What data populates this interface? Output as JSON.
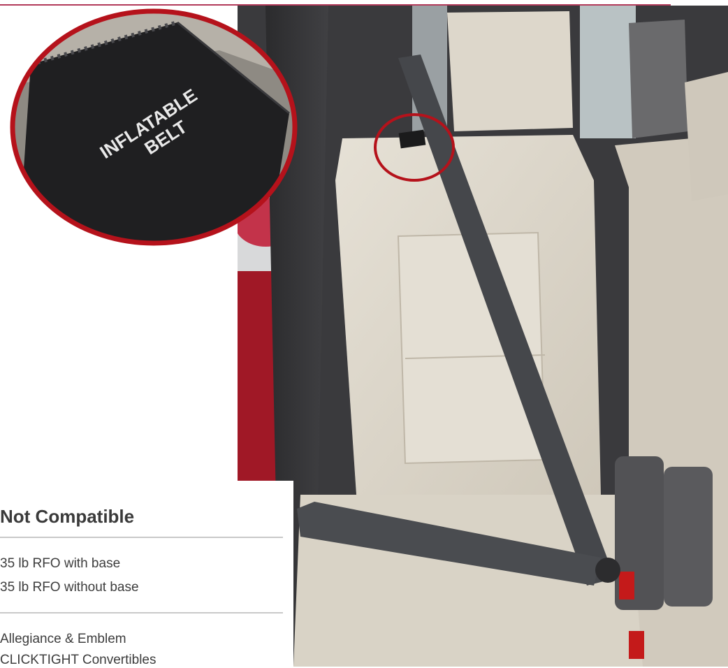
{
  "zoom_label": [
    "INFLATABLE",
    "BELT"
  ],
  "section": {
    "title": "Not Compatible",
    "group1": [
      "35 lb RFO with base",
      "35 lb RFO without base"
    ],
    "group2": [
      "Allegiance & Emblem",
      "CLICKTIGHT Convertibles"
    ]
  },
  "colors": {
    "accent": "#b23a5a",
    "circle": "#b5121b"
  }
}
